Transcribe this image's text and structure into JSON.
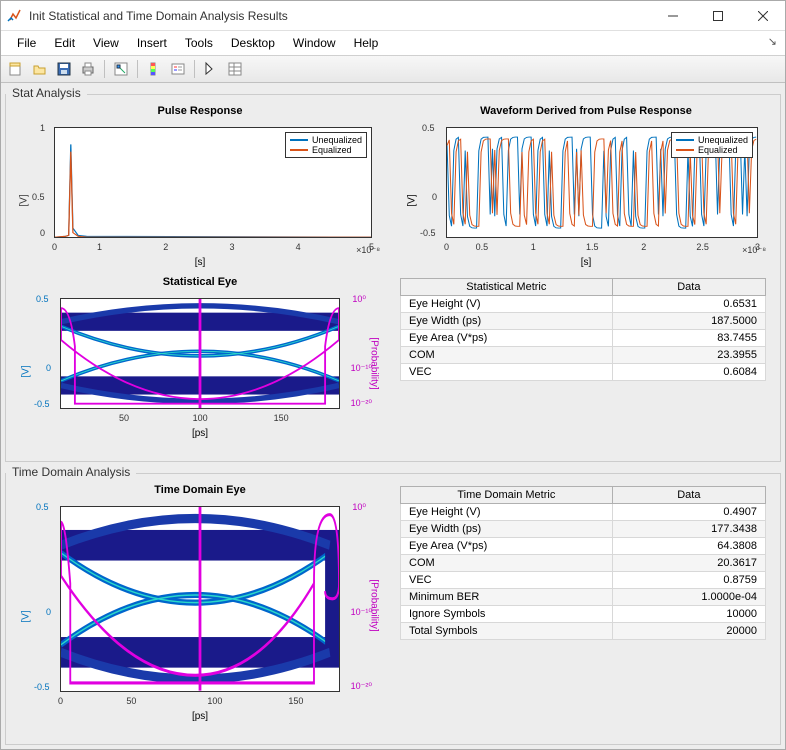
{
  "window": {
    "title": "Init Statistical and Time Domain Analysis Results"
  },
  "menu": {
    "file": "File",
    "edit": "Edit",
    "view": "View",
    "insert": "Insert",
    "tools": "Tools",
    "desktop": "Desktop",
    "window": "Window",
    "help": "Help"
  },
  "panels": {
    "stat": "Stat Analysis",
    "time": "Time Domain Analysis"
  },
  "charts": {
    "pulse": {
      "title": "Pulse Response",
      "ylabel": "[V]",
      "xlabel": "[s]",
      "xexp": "×10⁻⁸",
      "legend": [
        "Unequalized",
        "Equalized"
      ],
      "xticks": [
        "0",
        "1",
        "2",
        "3",
        "4",
        "5"
      ],
      "yticks": [
        "0",
        "0.5",
        "1"
      ]
    },
    "waveform": {
      "title": "Waveform Derived from Pulse Response",
      "ylabel": "[V]",
      "xlabel": "[s]",
      "xexp": "×10⁻⁸",
      "legend": [
        "Unequalized",
        "Equalized"
      ],
      "xticks": [
        "0",
        "0.5",
        "1",
        "1.5",
        "2",
        "2.5",
        "3"
      ],
      "yticks": [
        "-0.5",
        "0",
        "0.5"
      ]
    },
    "stat_eye": {
      "title": "Statistical Eye",
      "ylabel": "[V]",
      "y2label": "[Probability]",
      "xlabel": "[ps]",
      "xticks": [
        "50",
        "100",
        "150"
      ],
      "yticks": [
        "-0.5",
        "0",
        "0.5"
      ],
      "y2ticks": [
        "10⁻²⁰",
        "10⁻¹⁰",
        "10⁰"
      ]
    },
    "td_eye": {
      "title": "Time Domain Eye",
      "ylabel": "[V]",
      "y2label": "[Probability]",
      "xlabel": "[ps]",
      "xticks": [
        "0",
        "50",
        "100",
        "150"
      ],
      "yticks": [
        "-0.5",
        "0",
        "0.5"
      ],
      "y2ticks": [
        "10⁻²⁰",
        "10⁻¹⁰",
        "10⁰"
      ]
    }
  },
  "stat_table": {
    "headers": [
      "Statistical Metric",
      "Data"
    ],
    "rows": [
      [
        "Eye Height (V)",
        "0.6531"
      ],
      [
        "Eye Width (ps)",
        "187.5000"
      ],
      [
        "Eye Area (V*ps)",
        "83.7455"
      ],
      [
        "COM",
        "23.3955"
      ],
      [
        "VEC",
        "0.6084"
      ]
    ]
  },
  "td_table": {
    "headers": [
      "Time Domain Metric",
      "Data"
    ],
    "rows": [
      [
        "Eye Height (V)",
        "0.4907"
      ],
      [
        "Eye Width (ps)",
        "177.3438"
      ],
      [
        "Eye Area (V*ps)",
        "64.3808"
      ],
      [
        "COM",
        "20.3617"
      ],
      [
        "VEC",
        "0.8759"
      ],
      [
        "Minimum BER",
        "1.0000e-04"
      ],
      [
        "Ignore Symbols",
        "10000"
      ],
      [
        "Total Symbols",
        "20000"
      ]
    ]
  },
  "chart_data": [
    {
      "id": "pulse_response",
      "type": "line",
      "title": "Pulse Response",
      "xlabel": "[s]",
      "ylabel": "[V]",
      "xlim": [
        0,
        5e-08
      ],
      "ylim": [
        0,
        1
      ],
      "series": [
        {
          "name": "Unequalized",
          "color": "#0072BD",
          "x": [
            0,
            1.5e-09,
            2e-09,
            2.5e-09,
            3e-09,
            4e-09,
            1e-08,
            5e-08
          ],
          "y": [
            0,
            0.02,
            0.84,
            0.1,
            0.02,
            0.0,
            0.0,
            0.0
          ]
        },
        {
          "name": "Equalized",
          "color": "#D95319",
          "x": [
            0,
            1.5e-09,
            2e-09,
            2.5e-09,
            3e-09,
            4e-09,
            1e-08,
            5e-08
          ],
          "y": [
            0,
            0.02,
            0.78,
            0.05,
            0.01,
            0.0,
            0.0,
            0.0
          ]
        }
      ]
    },
    {
      "id": "waveform",
      "type": "line",
      "title": "Waveform Derived from Pulse Response",
      "xlabel": "[s]",
      "ylabel": "[V]",
      "xlim": [
        0,
        3e-08
      ],
      "ylim": [
        -0.5,
        0.5
      ],
      "note": "Dense alternating waveform approx ±0.42 amplitude across two series",
      "series": [
        {
          "name": "Unequalized",
          "color": "#0072BD"
        },
        {
          "name": "Equalized",
          "color": "#D95319"
        }
      ]
    },
    {
      "id": "statistical_eye",
      "type": "heatmap",
      "title": "Statistical Eye",
      "xlabel": "[ps]",
      "ylabel": "[V]",
      "y2label": "[Probability]",
      "xlim": [
        0,
        200
      ],
      "ylim": [
        -0.5,
        0.5
      ],
      "y2scale": "log",
      "y2lim": [
        1e-20,
        1
      ],
      "note": "Eye diagram with bathtub overlay in magenta"
    },
    {
      "id": "time_domain_eye",
      "type": "heatmap",
      "title": "Time Domain Eye",
      "xlabel": "[ps]",
      "ylabel": "[V]",
      "y2label": "[Probability]",
      "xlim": [
        0,
        190
      ],
      "ylim": [
        -0.5,
        0.5
      ],
      "y2scale": "log",
      "y2lim": [
        1e-20,
        1
      ],
      "note": "Eye diagram with bathtub overlay in magenta"
    }
  ]
}
